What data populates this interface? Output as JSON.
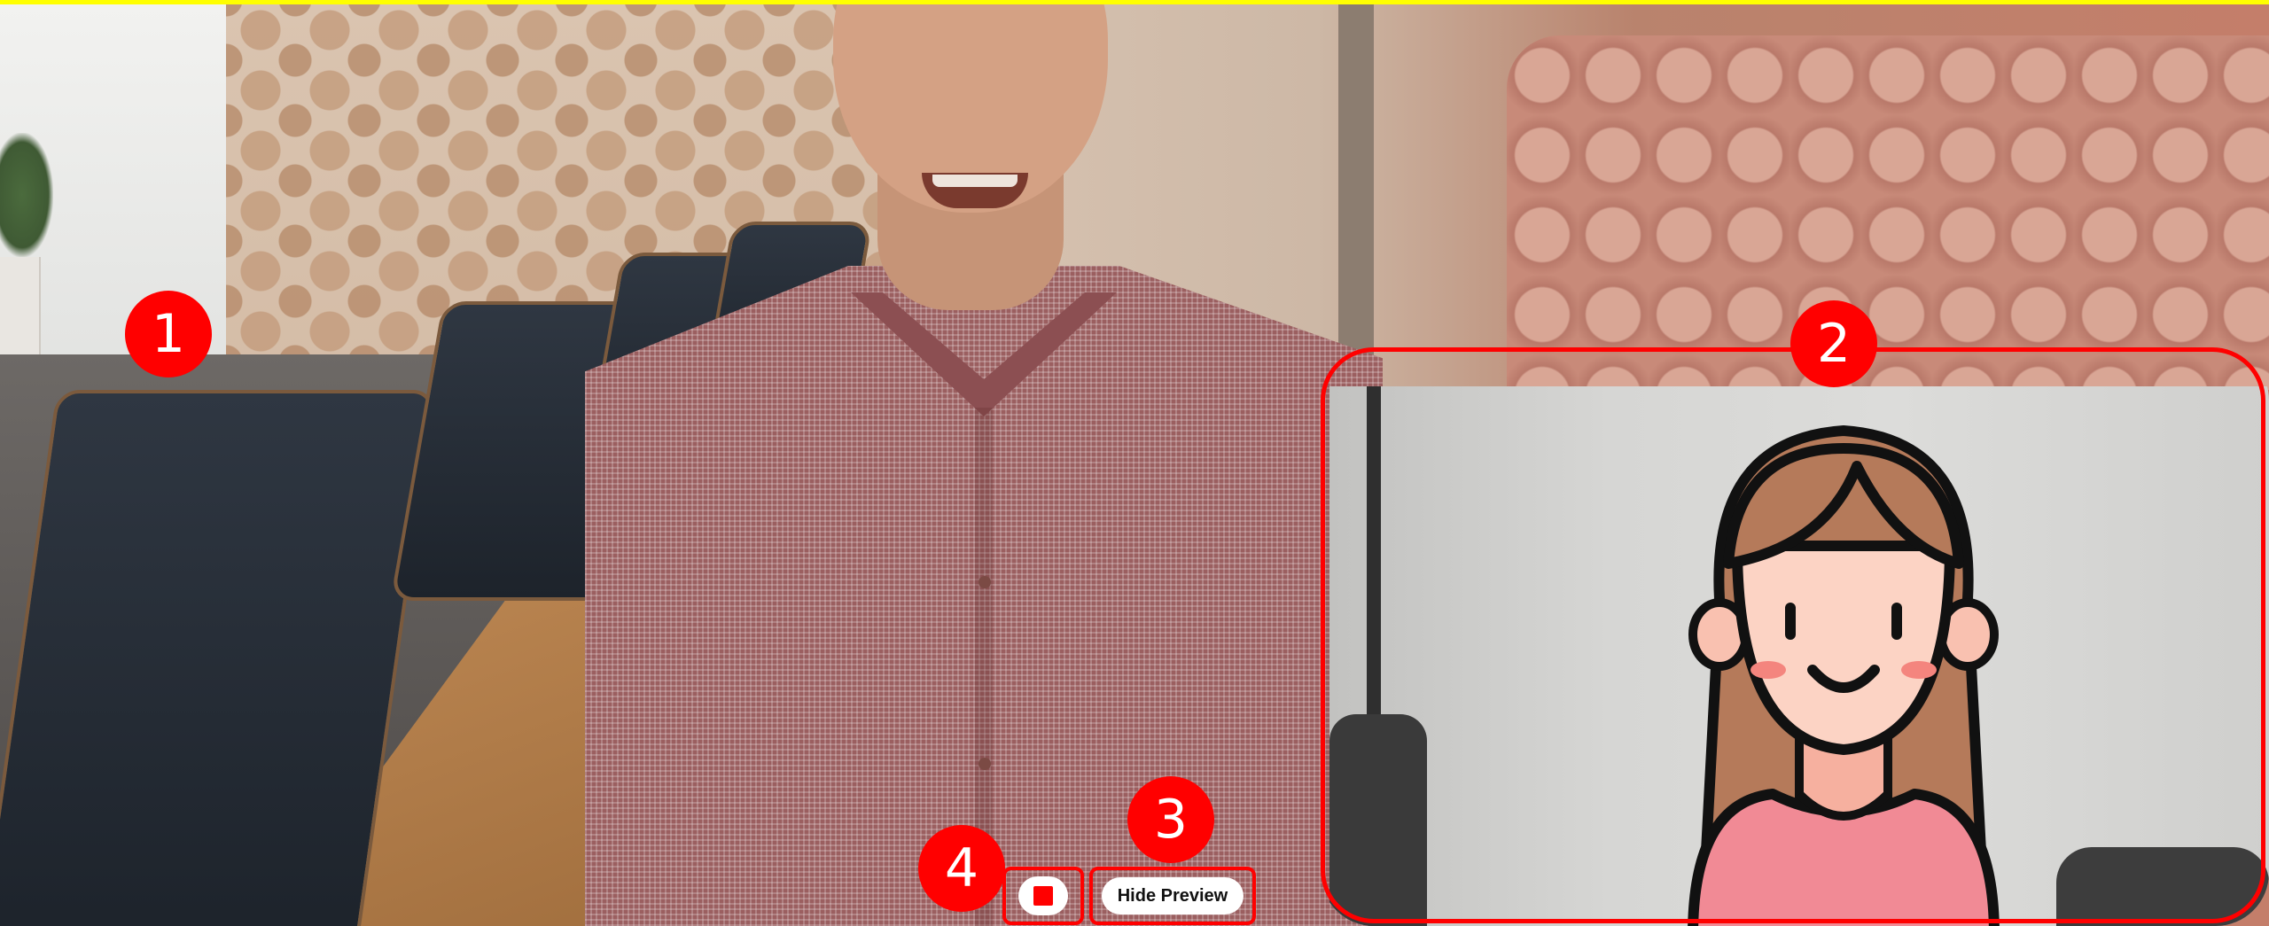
{
  "main_video": {
    "label": ""
  },
  "preview": {
    "label": ""
  },
  "controls": {
    "stop_icon": "stop-icon",
    "hide_preview_label": "Hide Preview"
  },
  "callouts": [
    "1",
    "2",
    "3",
    "4"
  ],
  "colors": {
    "annotation_red": "#ff0000",
    "top_strip": "#ffff00",
    "button_bg": "#ffffff"
  }
}
